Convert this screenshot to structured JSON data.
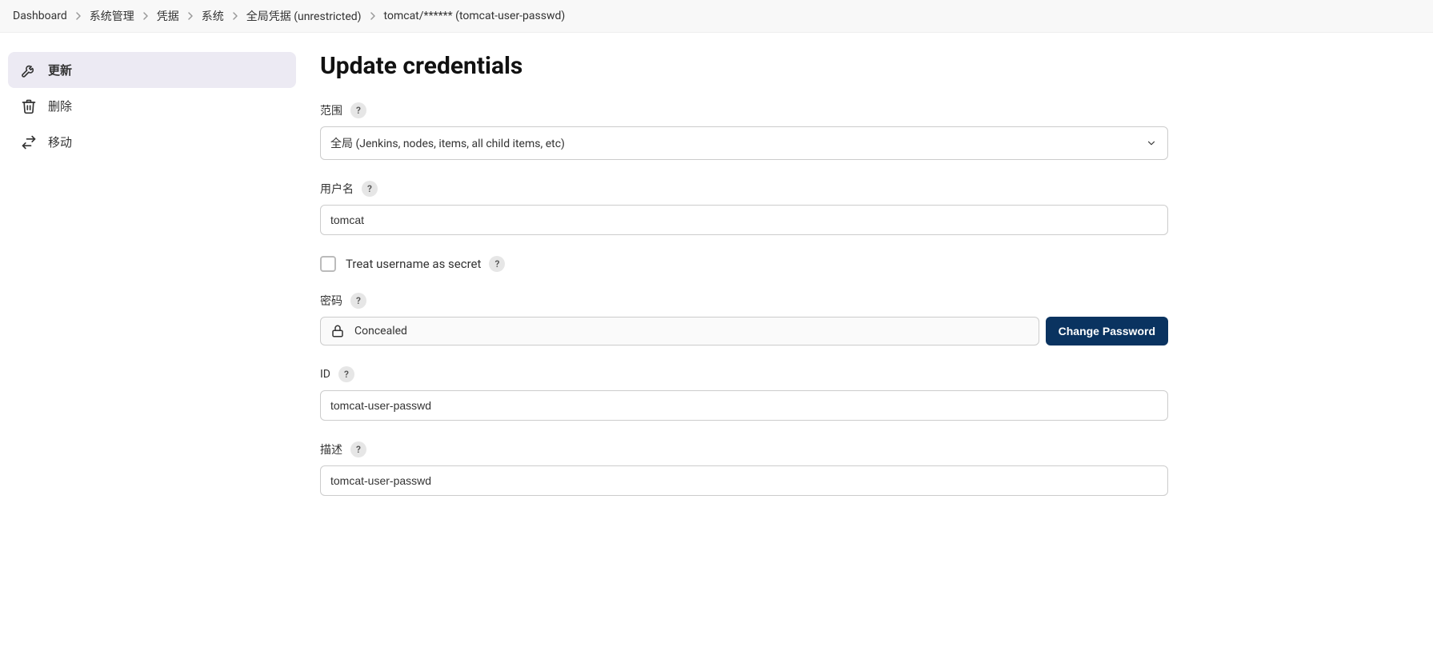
{
  "breadcrumb": [
    "Dashboard",
    "系统管理",
    "凭据",
    "系统",
    "全局凭据 (unrestricted)",
    "tomcat/****** (tomcat-user-passwd)"
  ],
  "sidebar": {
    "update": "更新",
    "delete": "删除",
    "move": "移动"
  },
  "page": {
    "title": "Update credentials"
  },
  "form": {
    "scope_label": "范围",
    "scope_value": "全局 (Jenkins, nodes, items, all child items, etc)",
    "username_label": "用户名",
    "username_value": "tomcat",
    "treat_secret_label": "Treat username as secret",
    "password_label": "密码",
    "password_concealed": "Concealed",
    "change_password_btn": "Change Password",
    "id_label": "ID",
    "id_value": "tomcat-user-passwd",
    "description_label": "描述",
    "description_value": "tomcat-user-passwd"
  },
  "help_char": "?"
}
